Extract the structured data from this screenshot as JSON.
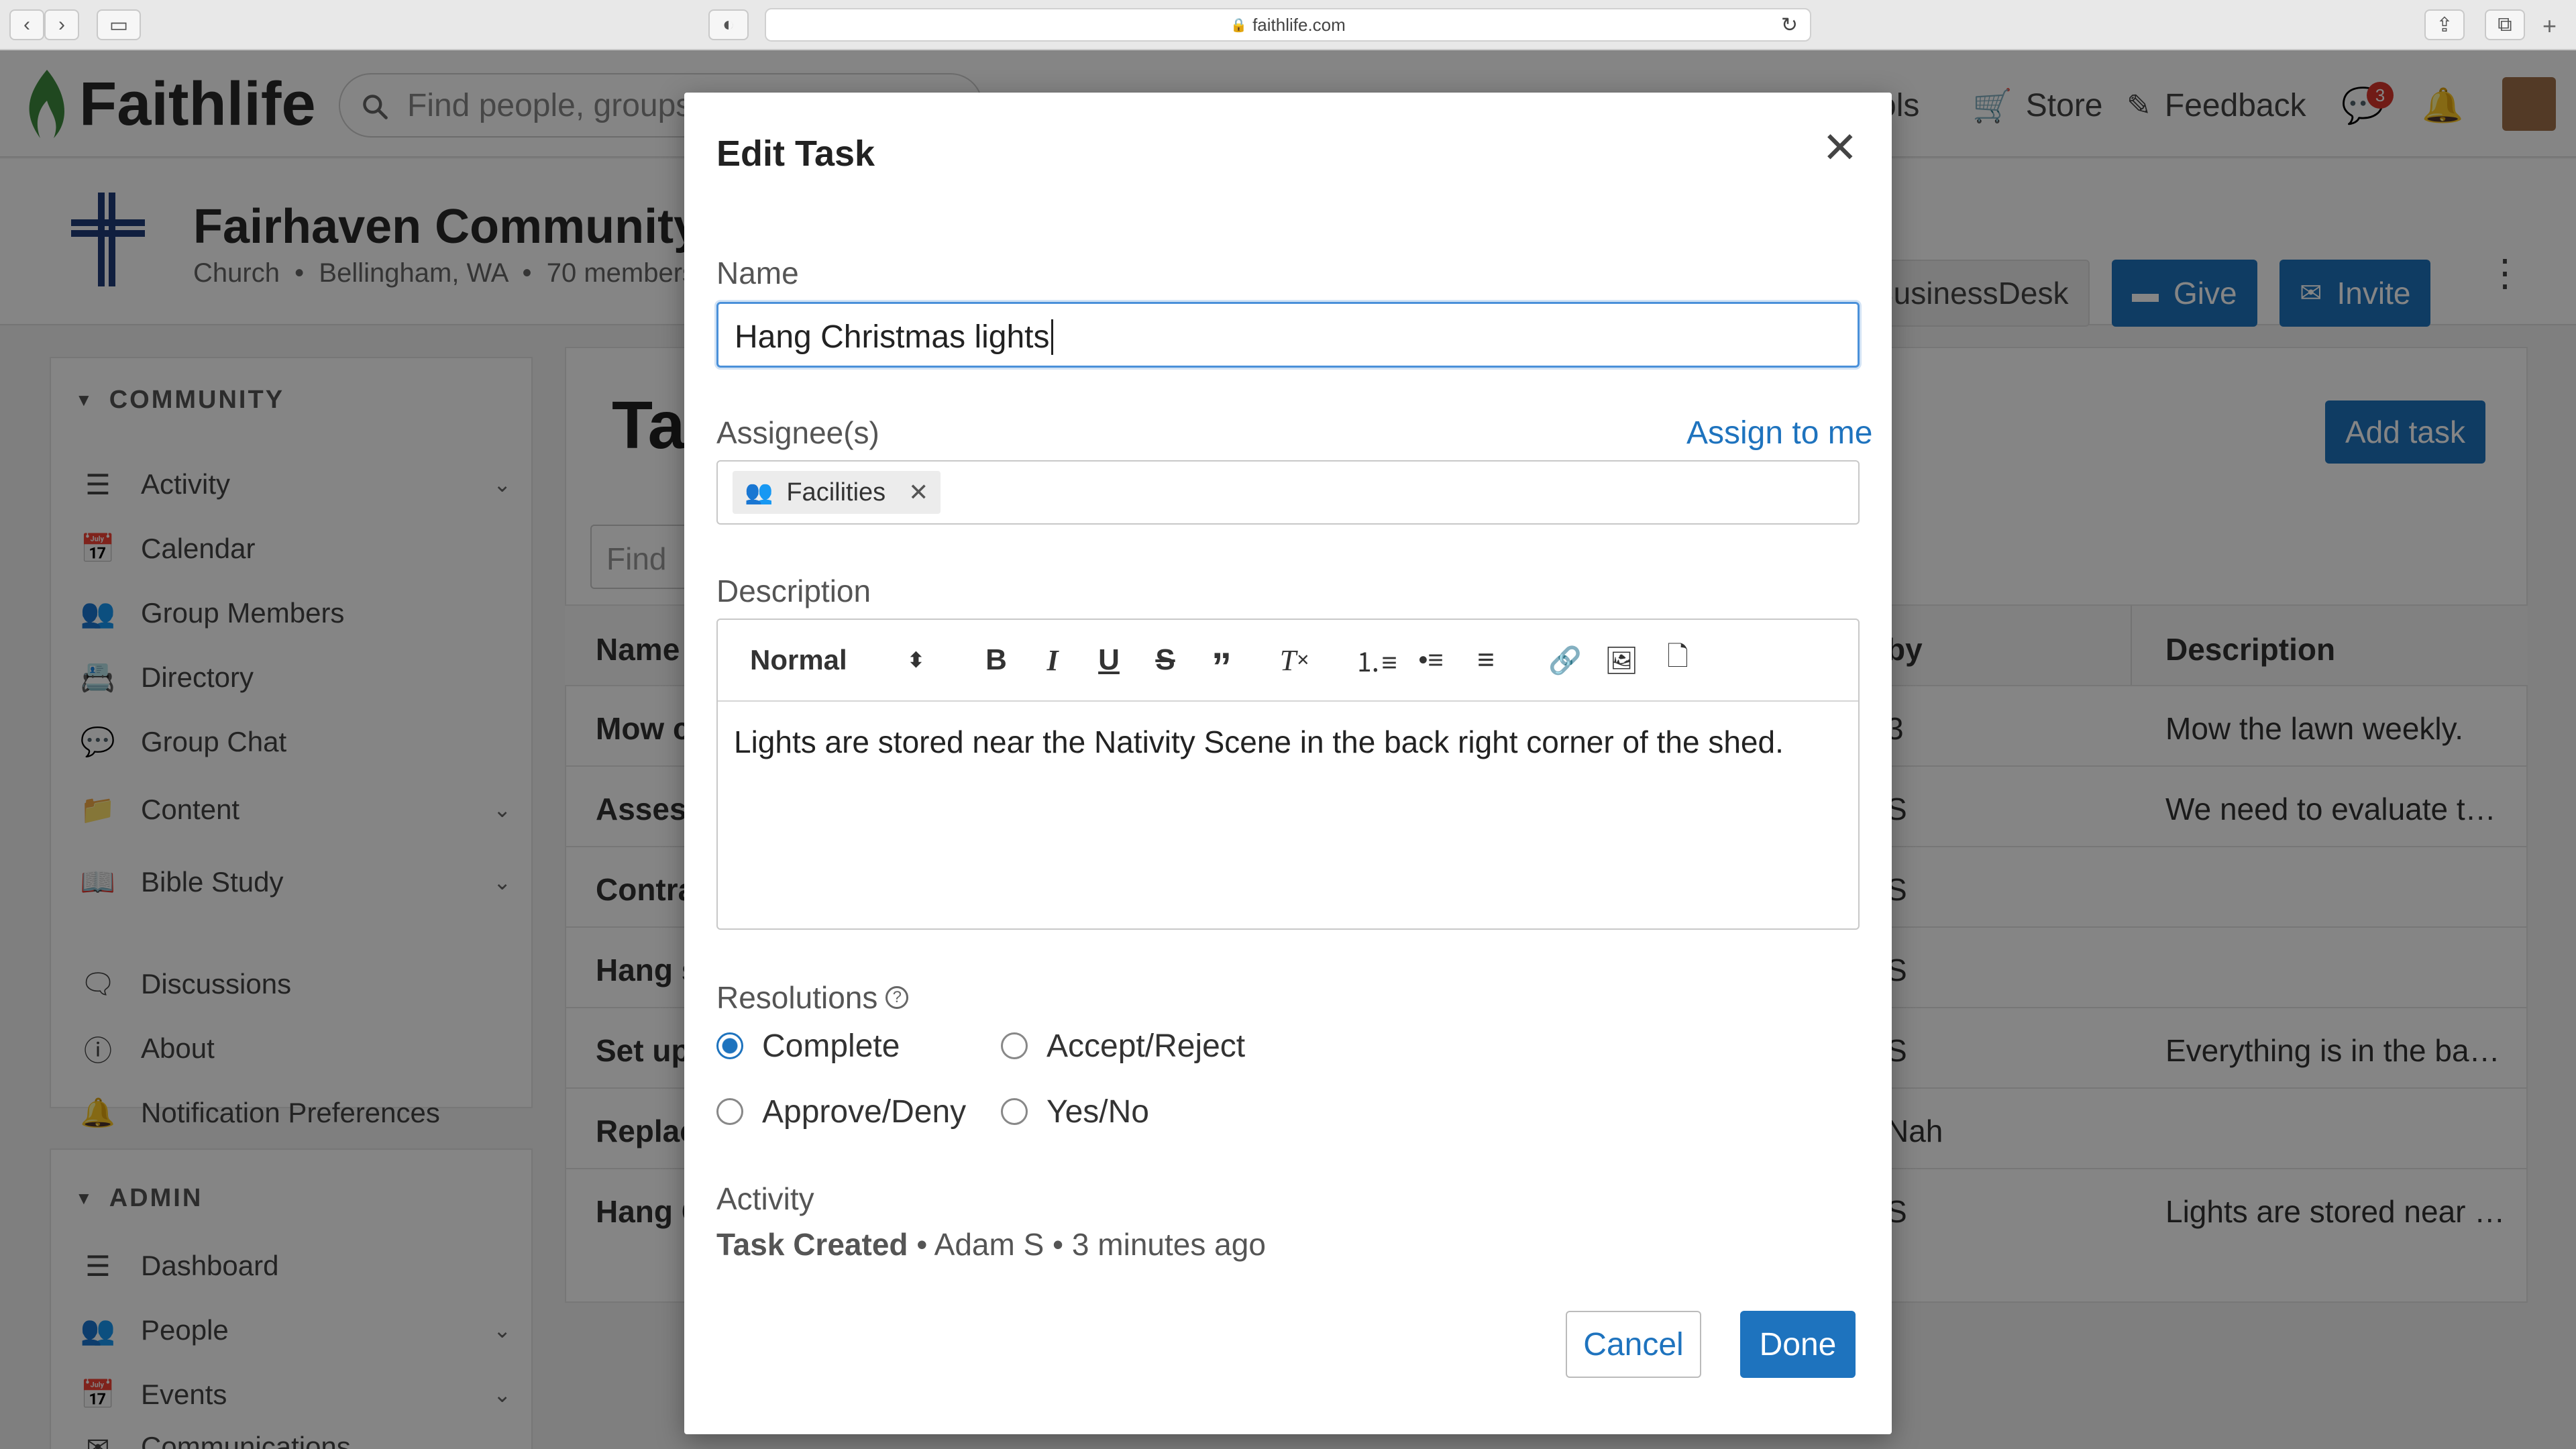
{
  "browser": {
    "url": "faithlife.com"
  },
  "topbar": {
    "logo": "Faithlife",
    "search_placeholder": "Find people, groups,",
    "nav_tools_fragment": "ols",
    "store": "Store",
    "feedback": "Feedback",
    "messages_badge": "3"
  },
  "group": {
    "name": "Fairhaven Community C",
    "type": "Church",
    "location": "Bellingham, WA",
    "members": "70 members",
    "businessdesk": "BusinessDesk",
    "give": "Give",
    "invite": "Invite"
  },
  "sidebar": {
    "community_header": "COMMUNITY",
    "community_items": [
      {
        "label": "Activity"
      },
      {
        "label": "Calendar"
      },
      {
        "label": "Group Members"
      },
      {
        "label": "Directory"
      },
      {
        "label": "Group Chat"
      },
      {
        "label": "Content"
      },
      {
        "label": "Bible Study"
      },
      {
        "label": "Discussions"
      },
      {
        "label": "About"
      },
      {
        "label": "Notification Preferences"
      }
    ],
    "admin_header": "ADMIN",
    "admin_items": [
      {
        "label": "Dashboard"
      },
      {
        "label": "People"
      },
      {
        "label": "Events"
      },
      {
        "label": "Communications"
      }
    ]
  },
  "tasks_page": {
    "title_fragment": "Ta",
    "add_task": "Add task",
    "find_placeholder": "Find",
    "col_name": "Name",
    "col_by_fragment": "by",
    "col_description": "Description",
    "rows": [
      {
        "name": "Mow c",
        "by": "3",
        "description": "Mow the lawn weekly."
      },
      {
        "name": "Assess",
        "by": "S",
        "description": "We need to evaluate t…"
      },
      {
        "name": "Contra",
        "by": "S",
        "description": ""
      },
      {
        "name": "Hang s",
        "by": "S",
        "description": ""
      },
      {
        "name": "Set up",
        "by": "S",
        "description": "Everything is in the ba…"
      },
      {
        "name": "Replac",
        "by": "Nah",
        "description": ""
      },
      {
        "name": "Hang C",
        "by": "S",
        "description": "Lights are stored near …"
      }
    ]
  },
  "modal": {
    "title": "Edit Task",
    "name_label": "Name",
    "name_value": "Hang Christmas lights",
    "assignees_label": "Assignee(s)",
    "assign_to_me": "Assign to me",
    "assignee_tag": "Facilities",
    "description_label": "Description",
    "format_select": "Normal",
    "description_text": "Lights are stored near the Nativity Scene in the back right corner of the shed.",
    "resolutions_label": "Resolutions",
    "resolution_options": [
      {
        "label": "Complete",
        "selected": true
      },
      {
        "label": "Accept/Reject",
        "selected": false
      },
      {
        "label": "Approve/Deny",
        "selected": false
      },
      {
        "label": "Yes/No",
        "selected": false
      }
    ],
    "activity_label": "Activity",
    "activity_event": "Task Created",
    "activity_meta": " • Adam S • 3 minutes ago",
    "cancel": "Cancel",
    "done": "Done"
  },
  "colors": {
    "accent": "#1e73be",
    "faithlife_green": "#3e8a3e",
    "badge_red": "#d9342b"
  }
}
